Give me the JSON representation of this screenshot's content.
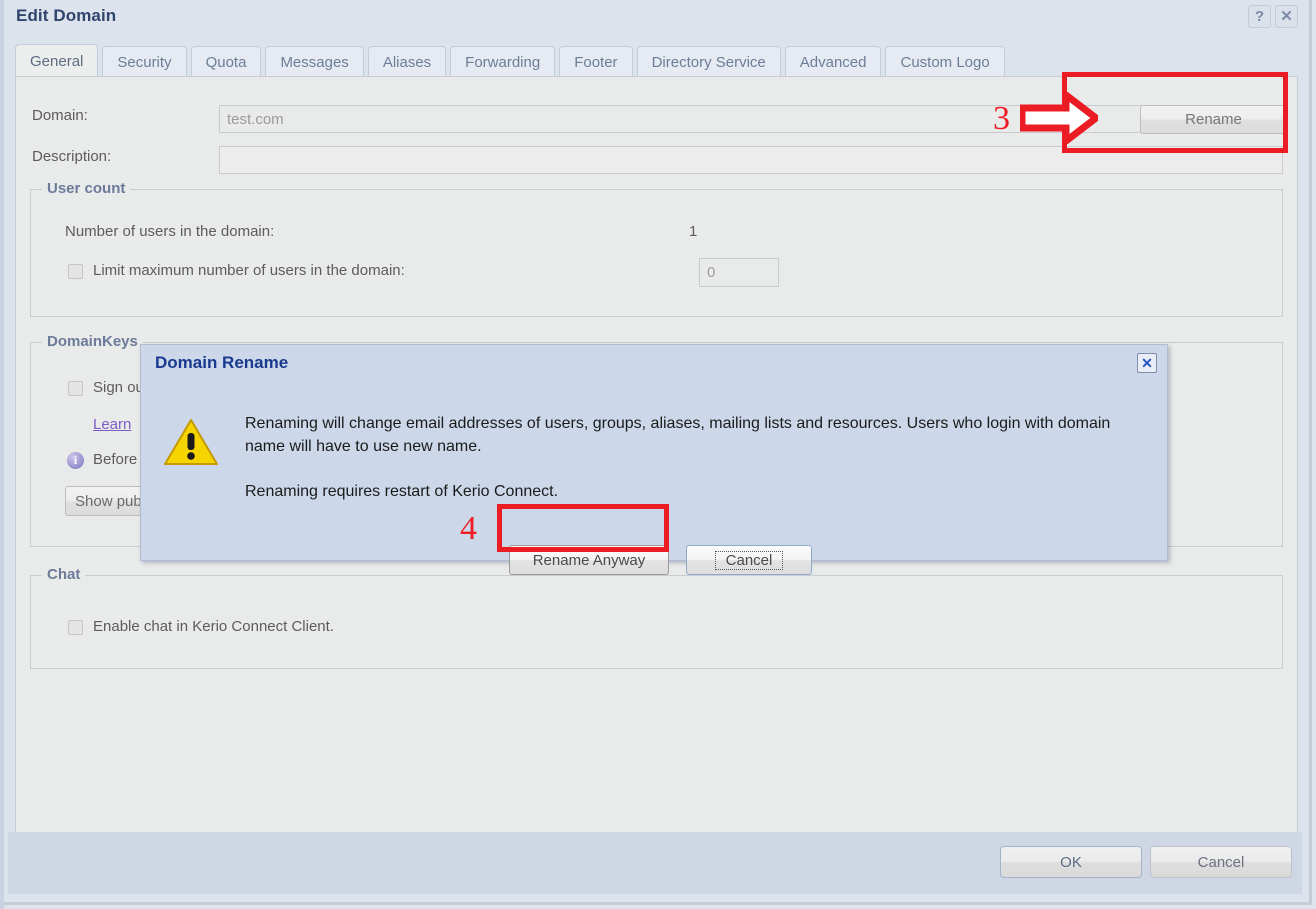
{
  "window": {
    "title": "Edit Domain",
    "help_label": "?",
    "close_label": "✕"
  },
  "tabs": [
    {
      "label": "General",
      "active": true
    },
    {
      "label": "Security",
      "active": false
    },
    {
      "label": "Quota",
      "active": false
    },
    {
      "label": "Messages",
      "active": false
    },
    {
      "label": "Aliases",
      "active": false
    },
    {
      "label": "Forwarding",
      "active": false
    },
    {
      "label": "Footer",
      "active": false
    },
    {
      "label": "Directory Service",
      "active": false
    },
    {
      "label": "Advanced",
      "active": false
    },
    {
      "label": "Custom Logo",
      "active": false
    }
  ],
  "general": {
    "domain_label": "Domain:",
    "domain_value": "test.com",
    "description_label": "Description:",
    "description_value": "",
    "rename_button": "Rename",
    "user_count": {
      "legend": "User count",
      "number_label": "Number of users in the domain:",
      "number_value": "1",
      "limit_label": "Limit maximum number of users in the domain:",
      "limit_value": "0",
      "limit_checked": false
    },
    "domainkeys": {
      "legend": "DomainKeys",
      "sign_label": "Sign ou",
      "sign_checked": false,
      "learn_link": "Learn ",
      "before_text": "Before",
      "show_button": "Show pub"
    },
    "chat": {
      "legend": "Chat",
      "enable_label": "Enable chat in Kerio Connect Client.",
      "enable_checked": false
    }
  },
  "footer": {
    "ok_label": "OK",
    "cancel_label": "Cancel"
  },
  "dialog": {
    "title": "Domain Rename",
    "close_label": "✕",
    "paragraph1": "Renaming will change email addresses of users, groups, aliases, mailing lists and resources. Users who login with domain name will have to use new name.",
    "paragraph2": "Renaming requires restart of Kerio Connect.",
    "rename_anyway_label": "Rename Anyway",
    "cancel_label": "Cancel"
  },
  "annotations": {
    "step3": "3",
    "step4": "4",
    "color": "#ec1c24"
  }
}
